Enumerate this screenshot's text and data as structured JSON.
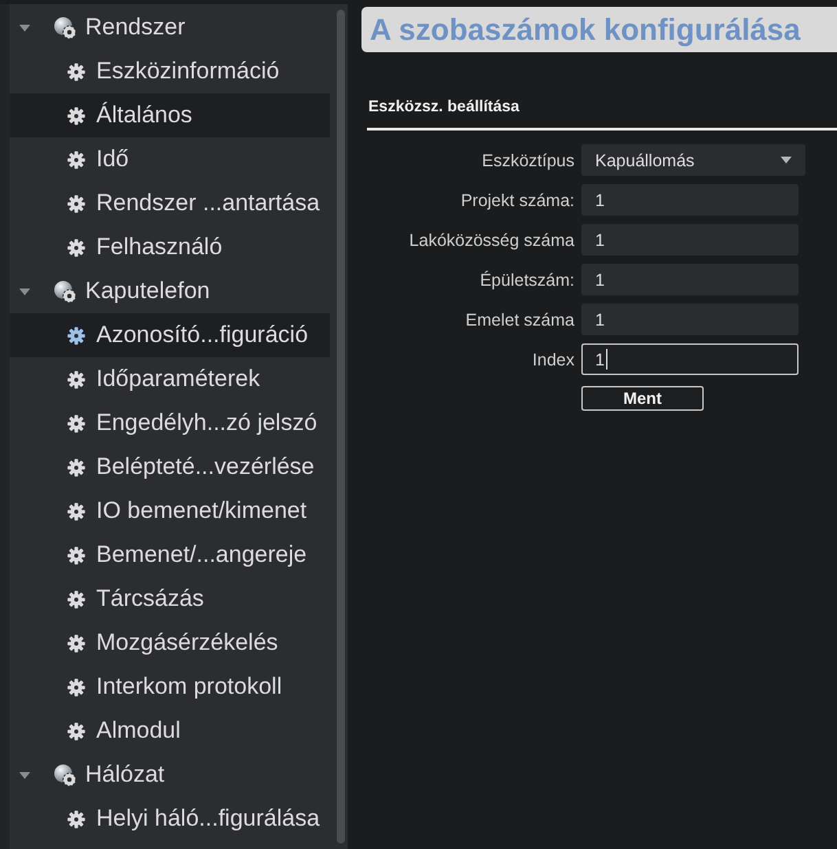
{
  "sidebar": {
    "groups": [
      {
        "label": "Rendszer",
        "expanded": true,
        "children": [
          {
            "label": "Eszközinformáció",
            "selected": false,
            "hovered": false
          },
          {
            "label": "Általános",
            "selected": false,
            "hovered": true
          },
          {
            "label": "Idő",
            "selected": false,
            "hovered": false
          },
          {
            "label": "Rendszer ...antartása",
            "selected": false,
            "hovered": false
          },
          {
            "label": "Felhasználó",
            "selected": false,
            "hovered": false
          }
        ]
      },
      {
        "label": "Kaputelefon",
        "expanded": true,
        "children": [
          {
            "label": "Azonosító...figuráció",
            "selected": true,
            "hovered": false
          },
          {
            "label": "Időparaméterek",
            "selected": false,
            "hovered": false
          },
          {
            "label": "Engedélyh...zó jelszó",
            "selected": false,
            "hovered": false
          },
          {
            "label": "Belépteté...vezérlése",
            "selected": false,
            "hovered": false
          },
          {
            "label": "IO bemenet/kimenet",
            "selected": false,
            "hovered": false
          },
          {
            "label": "Bemenet/...angereje",
            "selected": false,
            "hovered": false
          },
          {
            "label": "Tárcsázás",
            "selected": false,
            "hovered": false
          },
          {
            "label": "Mozgásérzékelés",
            "selected": false,
            "hovered": false
          },
          {
            "label": "Interkom protokoll",
            "selected": false,
            "hovered": false
          },
          {
            "label": "Almodul",
            "selected": false,
            "hovered": false
          }
        ]
      },
      {
        "label": "Hálózat",
        "expanded": true,
        "children": [
          {
            "label": "Helyi háló...figurálása",
            "selected": false,
            "hovered": false
          }
        ]
      }
    ]
  },
  "header": {
    "title": "A szobaszámok konfigurálása"
  },
  "section": {
    "title": "Eszközsz. beállítása"
  },
  "form": {
    "fields": [
      {
        "kind": "dropdown",
        "label": "Eszköztípus",
        "value": "Kapuállomás",
        "focused": false
      },
      {
        "kind": "text",
        "label": "Projekt száma:",
        "value": "1",
        "focused": false
      },
      {
        "kind": "text",
        "label": "Lakóközösség száma",
        "value": "1",
        "focused": false
      },
      {
        "kind": "text",
        "label": "Épületszám:",
        "value": "1",
        "focused": false
      },
      {
        "kind": "text",
        "label": "Emelet száma",
        "value": "1",
        "focused": false
      },
      {
        "kind": "text",
        "label": "Index",
        "value": "1",
        "focused": true
      }
    ],
    "buttons": [
      "Ment"
    ]
  }
}
